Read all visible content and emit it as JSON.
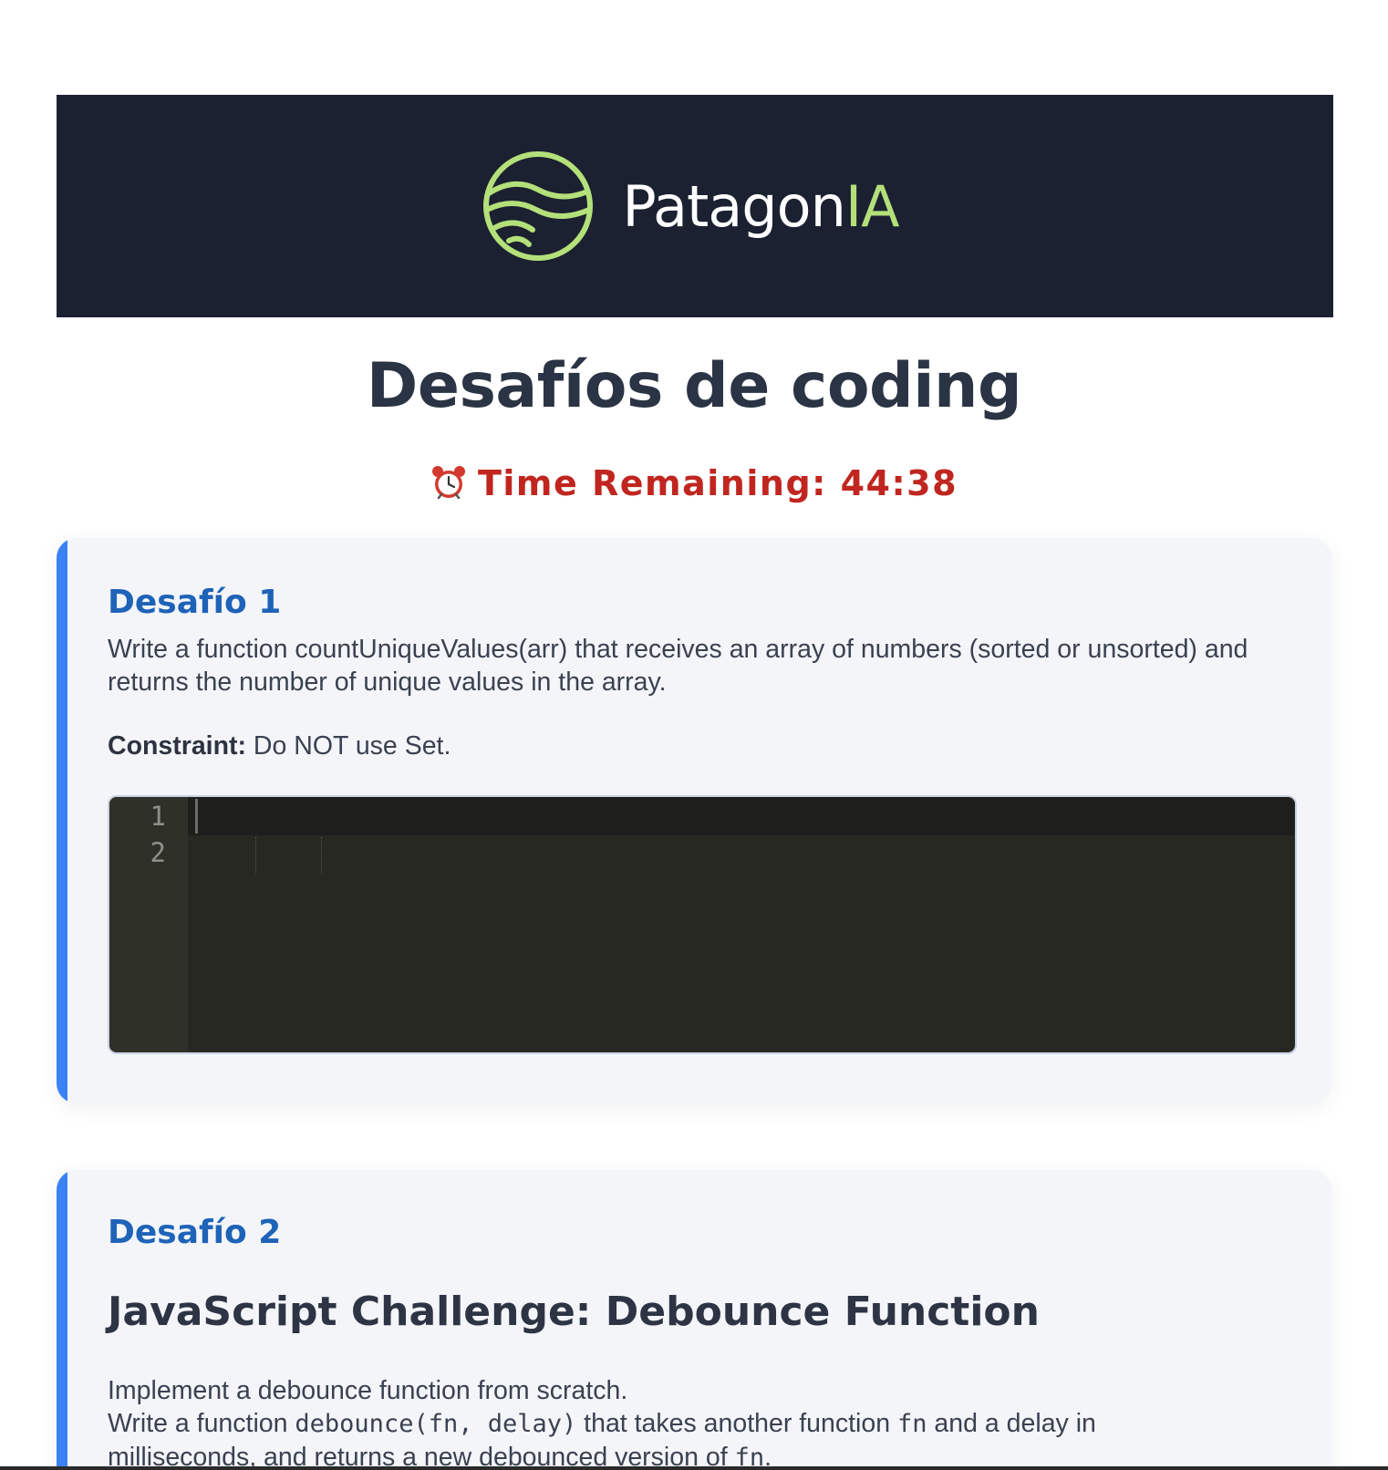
{
  "brand": {
    "name_main": "Patagon",
    "name_accent": "IA",
    "accent_color": "#b4e07a",
    "banner_color": "#1b2130",
    "logo_icon": "wave-circle-logo"
  },
  "page": {
    "title": "Desafíos de coding",
    "timer_icon": "alarm-clock-icon",
    "timer_text": "Time Remaining: 44:38"
  },
  "challenges": [
    {
      "heading": "Desafío 1",
      "description": "Write a function countUniqueValues(arr) that receives an array of numbers (sorted or unsorted) and returns the number of unique values in the array.",
      "constraint_label": "Constraint:",
      "constraint_text": " Do NOT use Set.",
      "editor": {
        "line_numbers": [
          "1",
          "2"
        ],
        "content": ""
      }
    },
    {
      "heading": "Desafío 2",
      "subtitle": "JavaScript Challenge: Debounce Function",
      "desc_line1": "Implement a debounce function from scratch.",
      "desc_line2_a": "Write a function ",
      "desc_line2_code": "debounce(fn, delay)",
      "desc_line2_b": " that takes another function ",
      "desc_line2_code2": "fn",
      "desc_line2_c": " and a delay in",
      "desc_line3_a": "milliseconds, and returns a new debounced version of ",
      "desc_line3_code": "fn",
      "desc_line3_b": "."
    }
  ],
  "colors": {
    "card_accent": "#3b82f6",
    "heading_blue": "#1e63b8",
    "timer_red": "#c0261f",
    "editor_bg": "#272822"
  }
}
